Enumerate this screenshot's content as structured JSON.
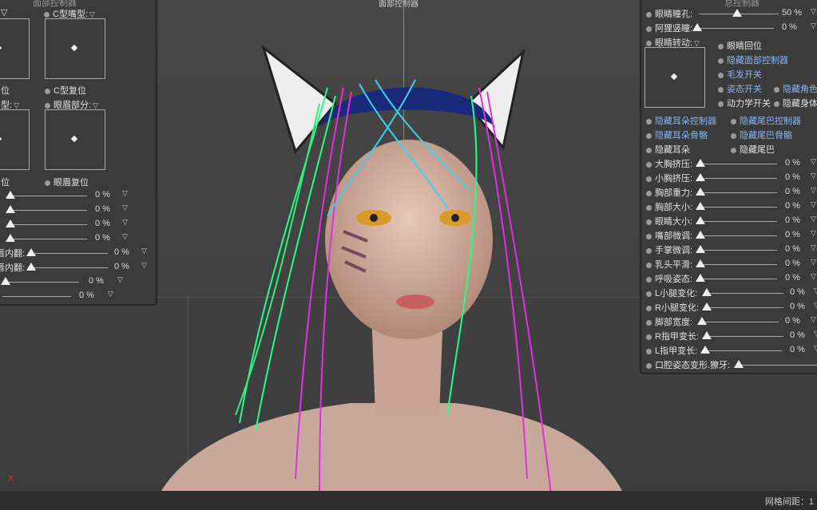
{
  "viewport": {
    "top_title": "面部控制器",
    "grid_spacing_label": "网格间距：1",
    "axis_label": "X"
  },
  "left_panel": {
    "header": "面部控制器",
    "mouth_type_label": "C型嘴型:",
    "left_reset_cut": "位",
    "mouth_reset": "C型复位",
    "type_cut": "型:",
    "eyebrow_part_label": "眼眉部分:",
    "left_reset_cut2": "位",
    "eyebrow_reset": "眼眉复位",
    "sliders": [
      {
        "label": "",
        "value": "0 %"
      },
      {
        "label": "",
        "value": "0 %"
      },
      {
        "label": "",
        "value": "0 %"
      },
      {
        "label": "",
        "value": "0 %"
      },
      {
        "label": "唇内翻:",
        "value": "0 %"
      },
      {
        "label": "唇内翻:",
        "value": "0 %"
      },
      {
        "label": "",
        "value": "0 %"
      },
      {
        "label": "",
        "value": "0 %"
      }
    ]
  },
  "right_panel": {
    "header": "总控制器",
    "pupil_label": "眼睛瞳孔:",
    "pupil_value": "50 %",
    "vertical_pupil_label": "阿狸竖瞳:",
    "vertical_pupil_value": "0 %",
    "eye_rotate_label": "眼睛转动:",
    "toggles_right": [
      "眼睛回位",
      "隐藏面部控制器",
      "毛发开关",
      "姿态开关",
      "动力学开关"
    ],
    "toggles_far": [
      "隐藏角色",
      "隐藏身体"
    ],
    "ear_toggles": [
      "隐藏耳朵控制器",
      "隐藏耳朵骨骼",
      "隐藏耳朵"
    ],
    "tail_toggles": [
      "隐藏尾巴控制器",
      "隐藏尾巴骨骼",
      "隐藏尾巴"
    ],
    "sliders": [
      {
        "label": "大胸挤压:",
        "value": "0 %"
      },
      {
        "label": "小胸挤压:",
        "value": "0 %"
      },
      {
        "label": "胸部重力:",
        "value": "0 %"
      },
      {
        "label": "胸部大小:",
        "value": "0 %"
      },
      {
        "label": "眼睛大小:",
        "value": "0 %"
      },
      {
        "label": "嘴部微调:",
        "value": "0 %"
      },
      {
        "label": "手掌微调:",
        "value": "0 %"
      },
      {
        "label": "乳头平滑:",
        "value": "0 %"
      },
      {
        "label": "呼吸姿态:",
        "value": "0 %"
      },
      {
        "label": "L小腿变化:",
        "value": "0 %"
      },
      {
        "label": "R小腿变化:",
        "value": "0 %"
      },
      {
        "label": "脚部宽度:",
        "value": "0 %"
      },
      {
        "label": "R指甲变长:",
        "value": "0 %"
      },
      {
        "label": "L指甲变长:",
        "value": "0 %"
      },
      {
        "label": "口腔姿态变形.獠牙:",
        "value": ""
      }
    ]
  }
}
